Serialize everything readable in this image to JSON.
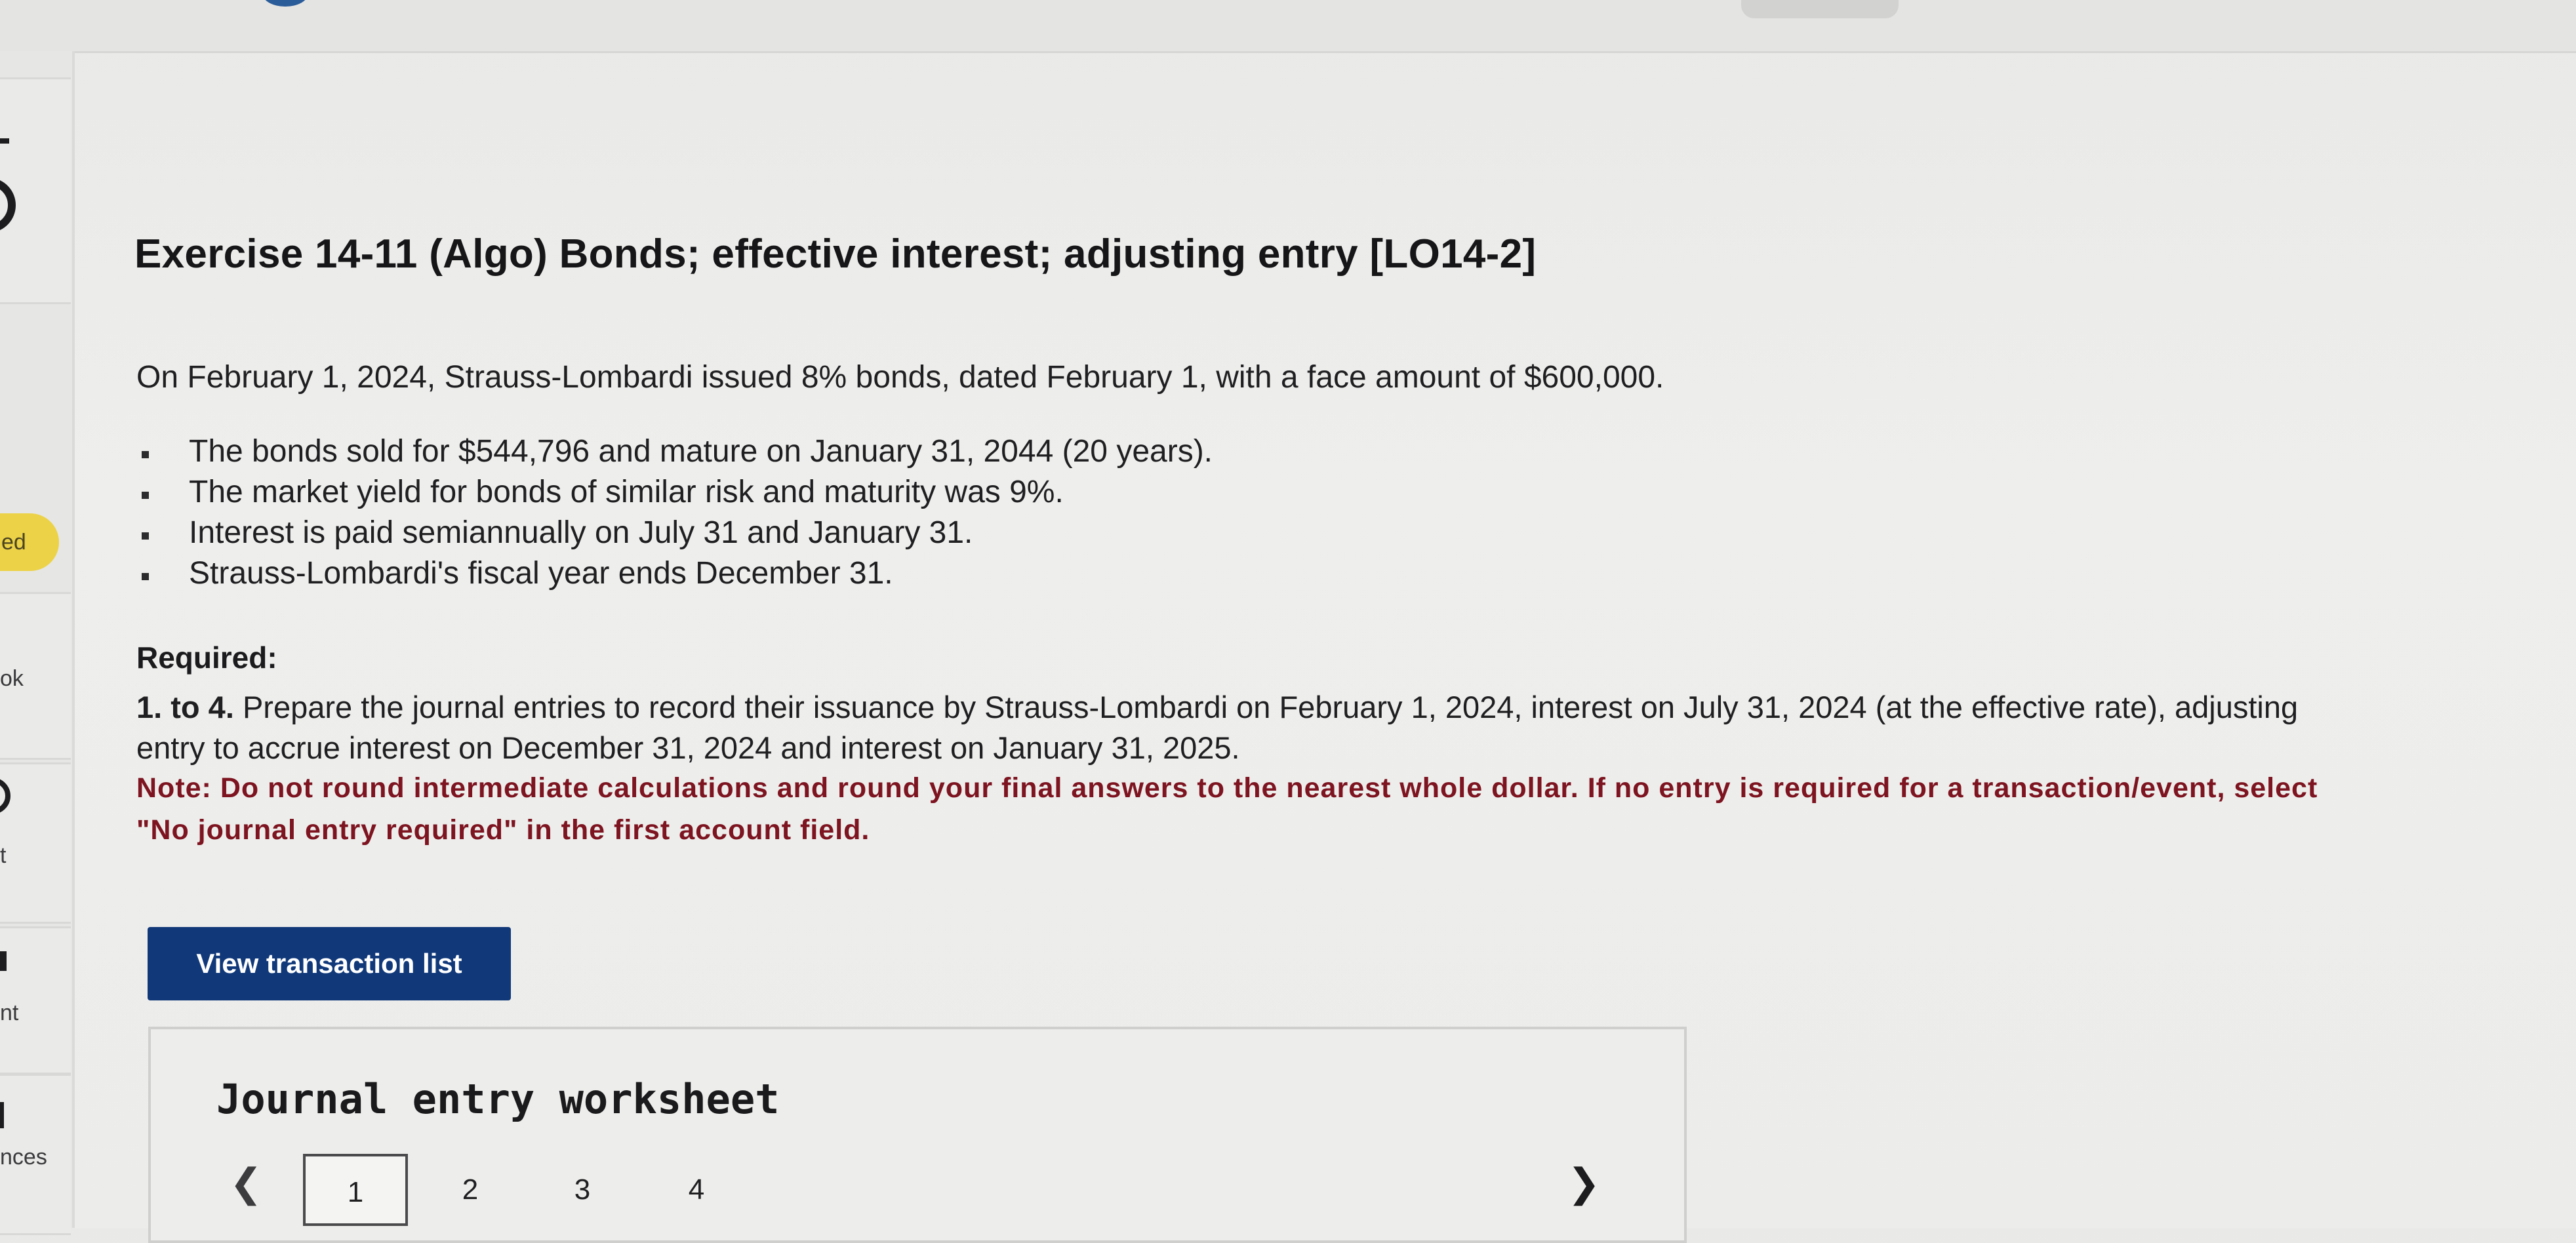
{
  "sidebar": {
    "items": [
      {
        "label": "ed"
      },
      {
        "label": "ok"
      },
      {
        "label": "t"
      },
      {
        "label": "nt"
      },
      {
        "label": "nces"
      }
    ]
  },
  "exercise": {
    "title": "Exercise 14-11 (Algo) Bonds; effective interest; adjusting entry [LO14-2]",
    "intro": "On February 1, 2024, Strauss-Lombardi issued 8% bonds, dated February 1, with a face amount of $600,000.",
    "bullets": [
      "The bonds sold for $544,796 and mature on January 31, 2044 (20 years).",
      "The market yield for bonds of similar risk and maturity was 9%.",
      "Interest is paid semiannually on July 31 and January 31.",
      "Strauss-Lombardi's fiscal year ends December 31."
    ]
  },
  "required": {
    "heading": "Required:",
    "number": "1. to 4.",
    "text": "Prepare the journal entries to record their issuance by Strauss-Lombardi on February 1, 2024, interest on July 31, 2024 (at the effective rate), adjusting entry to accrue interest on December 31, 2024 and interest on January 31, 2025.",
    "note": "Note: Do not round intermediate calculations and round your final answers to the nearest whole dollar. If no entry is required for a transaction/event, select \"No journal entry required\" in the first account field."
  },
  "buttons": {
    "view_transaction_list": "View transaction list"
  },
  "worksheet": {
    "title": "Journal entry worksheet",
    "prev_icon": "chevron-left-icon",
    "next_icon": "chevron-right-icon",
    "pages": [
      "1",
      "2",
      "3",
      "4"
    ],
    "active_page": "1"
  }
}
